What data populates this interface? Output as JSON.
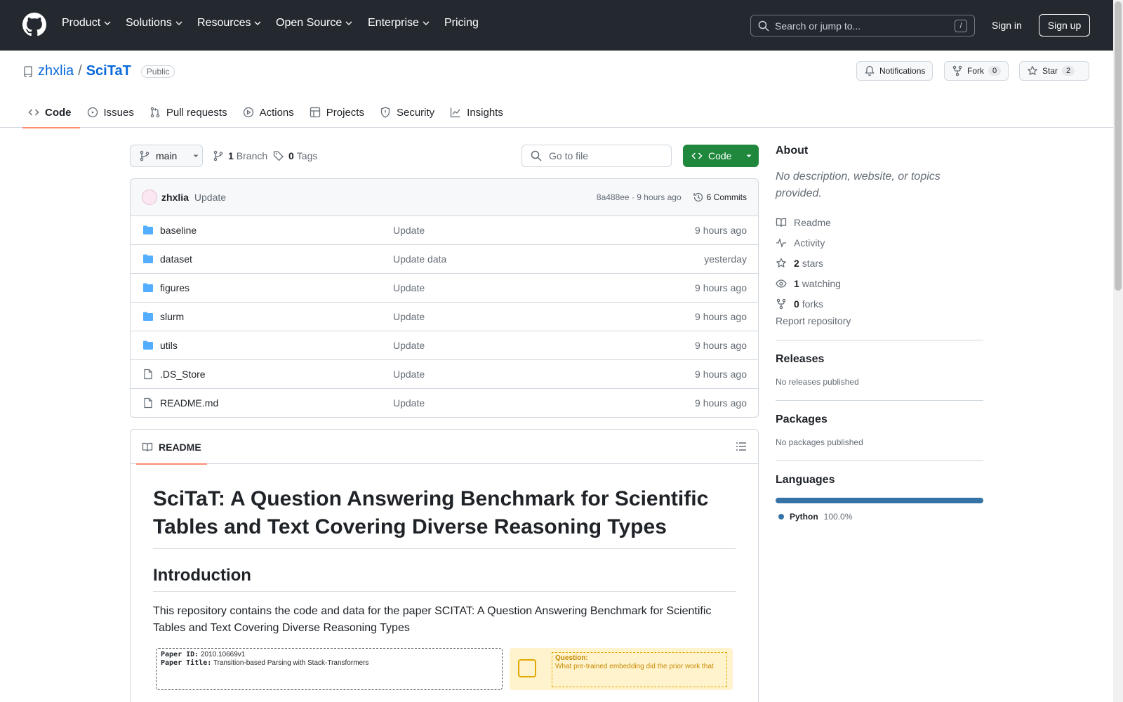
{
  "header": {
    "nav": [
      "Product",
      "Solutions",
      "Resources",
      "Open Source",
      "Enterprise",
      "Pricing"
    ],
    "search_placeholder": "Search or jump to...",
    "search_key": "/",
    "signin": "Sign in",
    "signup": "Sign up"
  },
  "repo": {
    "owner": "zhxlia",
    "sep": "/",
    "name": "SciTaT",
    "visibility": "Public",
    "notifications_label": "Notifications",
    "fork_label": "Fork",
    "fork_count": "0",
    "star_label": "Star",
    "star_count": "2",
    "tabs": [
      "Code",
      "Issues",
      "Pull requests",
      "Actions",
      "Projects",
      "Security",
      "Insights"
    ]
  },
  "toolbar": {
    "branch": "main",
    "branch_count": "1",
    "branch_label": "Branch",
    "tag_count": "0",
    "tag_label": "Tags",
    "goto_placeholder": "Go to file",
    "code_label": "Code"
  },
  "commit": {
    "author": "zhxlia",
    "message": "Update",
    "hash_time": "8a488ee · 9 hours ago",
    "commits_count": "6 Commits"
  },
  "files": [
    {
      "name": "baseline",
      "type": "folder",
      "message": "Update",
      "date": "9 hours ago"
    },
    {
      "name": "dataset",
      "type": "folder",
      "message": "Update data",
      "date": "yesterday"
    },
    {
      "name": "figures",
      "type": "folder",
      "message": "Update",
      "date": "9 hours ago"
    },
    {
      "name": "slurm",
      "type": "folder",
      "message": "Update",
      "date": "9 hours ago"
    },
    {
      "name": "utils",
      "type": "folder",
      "message": "Update",
      "date": "9 hours ago"
    },
    {
      "name": ".DS_Store",
      "type": "file",
      "message": "Update",
      "date": "9 hours ago"
    },
    {
      "name": "README.md",
      "type": "file",
      "message": "Update",
      "date": "9 hours ago"
    }
  ],
  "readme": {
    "tab_label": "README",
    "title": "SciTaT: A Question Answering Benchmark for Scientific Tables and Text Covering Diverse Reasoning Types",
    "intro_heading": "Introduction",
    "intro_text": "This repository contains the code and data for the paper SCITAT: A Question Answering Benchmark for Scientific Tables and Text Covering Diverse Reasoning Types",
    "fig_paper_id_label": "Paper ID:",
    "fig_paper_id": "2010.10669v1",
    "fig_paper_title_label": "Paper Title:",
    "fig_paper_title": "Transition-based Parsing with Stack-Transformers",
    "fig_question_label": "Question:",
    "fig_question": "What pre-trained embedding did the prior work that"
  },
  "sidebar": {
    "about_heading": "About",
    "description": "No description, website, or topics provided.",
    "links": [
      {
        "icon": "book-icon",
        "bold": "",
        "text": "Readme"
      },
      {
        "icon": "pulse-icon",
        "bold": "",
        "text": "Activity"
      },
      {
        "icon": "star-icon",
        "bold": "2",
        "text": "stars"
      },
      {
        "icon": "eye-icon",
        "bold": "1",
        "text": "watching"
      },
      {
        "icon": "fork-icon",
        "bold": "0",
        "text": "forks"
      }
    ],
    "report": "Report repository",
    "releases_heading": "Releases",
    "releases_text": "No releases published",
    "packages_heading": "Packages",
    "packages_text": "No packages published",
    "languages_heading": "Languages",
    "language": "Python",
    "language_pct": "100.0%",
    "language_color": "#3572A5"
  },
  "colors": {
    "header_bg": "#24292f",
    "link": "#0969da",
    "code_button": "#1f883d",
    "tab_underline": "#fd8c73",
    "folder": "#54aeff"
  }
}
